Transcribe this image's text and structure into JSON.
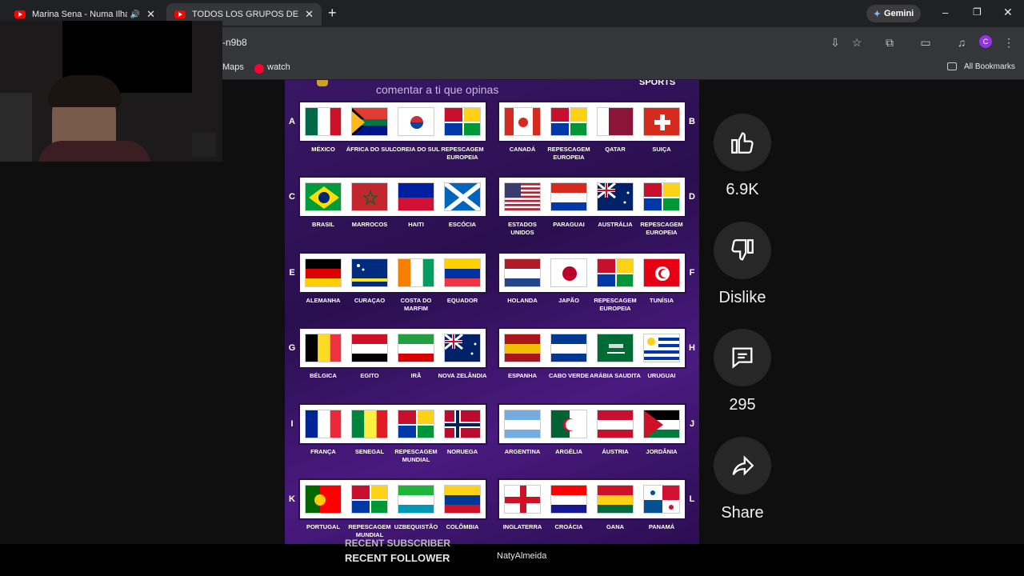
{
  "browser": {
    "tabs": [
      {
        "title": "Marina Sena - Numa Ilha (L",
        "active": false
      },
      {
        "title": "TODOS LOS GRUPOS DEL MUN",
        "active": true
      }
    ],
    "new_tab": "+",
    "gemini": "Gemini",
    "address": "-n9b8",
    "bookmarks": [
      "Maps",
      "watch"
    ],
    "all_bookmarks": "All Bookmarks",
    "profile_initial": "C"
  },
  "video": {
    "header_text": "comentar a ti que opinas",
    "brand": "SPORTS",
    "groups": [
      {
        "letter": "A",
        "side": "left",
        "countries": [
          "MÉXICO",
          "ÁFRICA DO SUL",
          "COREIA DO SUL",
          "REPESCAGEM EUROPEIA"
        ]
      },
      {
        "letter": "B",
        "side": "right",
        "countries": [
          "CANADÁ",
          "REPESCAGEM EUROPEIA",
          "QATAR",
          "SUIÇA"
        ]
      },
      {
        "letter": "C",
        "side": "left",
        "countries": [
          "BRASIL",
          "MARROCOS",
          "HAITI",
          "ESCÓCIA"
        ]
      },
      {
        "letter": "D",
        "side": "right",
        "countries": [
          "ESTADOS UNIDOS",
          "PARAGUAI",
          "AUSTRÁLIA",
          "REPESCAGEM EUROPEIA"
        ]
      },
      {
        "letter": "E",
        "side": "left",
        "countries": [
          "ALEMANHA",
          "CURAÇAO",
          "COSTA DO MARFIM",
          "EQUADOR"
        ]
      },
      {
        "letter": "F",
        "side": "right",
        "countries": [
          "HOLANDA",
          "JAPÃO",
          "REPESCAGEM EUROPEIA",
          "TUNÍSIA"
        ]
      },
      {
        "letter": "G",
        "side": "left",
        "countries": [
          "BÉLGICA",
          "EGITO",
          "IRÃ",
          "NOVA ZELÂNDIA"
        ]
      },
      {
        "letter": "H",
        "side": "right",
        "countries": [
          "ESPANHA",
          "CABO VERDE",
          "ARÁBIA SAUDITA",
          "URUGUAI"
        ]
      },
      {
        "letter": "I",
        "side": "left",
        "countries": [
          "FRANÇA",
          "SENEGAL",
          "REPESCAGEM MUNDIAL",
          "NORUEGA"
        ]
      },
      {
        "letter": "J",
        "side": "right",
        "countries": [
          "ARGENTINA",
          "ARGÉLIA",
          "ÁUSTRIA",
          "JORDÂNIA"
        ]
      },
      {
        "letter": "K",
        "side": "left",
        "countries": [
          "PORTUGAL",
          "REPESCAGEM MUNDIAL",
          "UZBEQUISTÃO",
          "COLÔMBIA"
        ]
      },
      {
        "letter": "L",
        "side": "right",
        "countries": [
          "INGLATERRA",
          "CROÁCIA",
          "GANA",
          "PANAMÁ"
        ]
      }
    ]
  },
  "actions": {
    "like_count": "6.9K",
    "dislike_label": "Dislike",
    "comment_count": "295",
    "share_label": "Share"
  },
  "overlay": {
    "recent_subscriber": "RECENT SUBSCRIBER",
    "recent_follower": "RECENT FOLLOWER",
    "follower_name": "NatyAlmeida"
  }
}
